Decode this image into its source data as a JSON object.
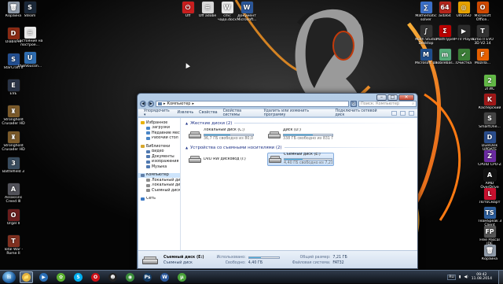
{
  "desktop": {
    "icons_left": [
      {
        "label": "Корзина",
        "color": "#8f9aa8",
        "icon": "recycle-bin-icon",
        "glyph": "🗑"
      },
      {
        "label": "Diablo III",
        "color": "#8a2a14",
        "icon": "diablo-icon",
        "glyph": "D"
      },
      {
        "label": "StarCraft II",
        "color": "#234e8f",
        "icon": "starcraft-icon",
        "glyph": "S"
      },
      {
        "label": "EVE",
        "color": "#2a3447",
        "icon": "eve-icon",
        "glyph": "E"
      },
      {
        "label": "Stronghold Crusader HD",
        "color": "#7b5a2a",
        "icon": "stronghold-icon",
        "glyph": "♜"
      },
      {
        "label": "Stronghold Crusader HD",
        "color": "#7b5a2a",
        "icon": "stronghold-icon",
        "glyph": "♜"
      },
      {
        "label": "Battlefield 3",
        "color": "#394c5e",
        "icon": "battlefield-icon",
        "glyph": "3"
      },
      {
        "label": "Assassins Creed III",
        "color": "#52525a",
        "icon": "assassins-icon",
        "glyph": "A"
      },
      {
        "label": "Orgel II",
        "color": "#6b1d1d",
        "icon": "game-icon",
        "glyph": "O"
      },
      {
        "label": "Total War - Rome II",
        "color": "#803020",
        "icon": "totalwar-icon",
        "glyph": "T"
      }
    ],
    "icons_left2": [
      {
        "label": "Steam",
        "color": "#1b2838",
        "icon": "steam-icon",
        "glyph": "S"
      },
      {
        "label": "Состояние на построе...",
        "color": "#e8e8e8",
        "icon": "document-icon",
        "glyph": "≡"
      },
      {
        "label": "USBVoucon...",
        "color": "#2f6db0",
        "icon": "usb-icon",
        "glyph": "U"
      }
    ],
    "icons_top": [
      {
        "label": "Off",
        "color": "#c81e1e",
        "icon": "power-icon",
        "glyph": "⏻"
      },
      {
        "label": "Off adobe",
        "color": "#d8d8d8",
        "icon": "document-icon",
        "glyph": "≡"
      },
      {
        "label": "cmc чадо.docx",
        "color": "#e8e8e8",
        "icon": "word-document-icon",
        "glyph": "W"
      },
      {
        "label": "Документ Microsoft...",
        "color": "#2b579a",
        "icon": "word-document-icon",
        "glyph": "W"
      }
    ],
    "icons_right": [
      {
        "label": "Mathematic solver",
        "color": "#3b6fc8",
        "icon": "math-icon",
        "glyph": "∑"
      },
      {
        "label": "aida64",
        "color": "#b4261c",
        "icon": "aida-icon",
        "glyph": "64"
      },
      {
        "label": "UltraISO",
        "color": "#e5a100",
        "icon": "ultraiso-icon",
        "glyph": "◎"
      },
      {
        "label": "Microsoft Office..",
        "color": "#d04a02",
        "icon": "office-icon",
        "glyph": "O"
      },
      {
        "label": "Math Studio Desktop",
        "color": "#333",
        "icon": "mathstudio-icon",
        "glyph": "∫"
      },
      {
        "label": "MathType",
        "color": "#b00",
        "icon": "mathtype-icon",
        "glyph": "Σ"
      },
      {
        "label": "IP-TV Player",
        "color": "#2a2a2a",
        "icon": "iptv-icon",
        "glyph": "▶"
      },
      {
        "label": "Turbo II EVO 3D V2.14",
        "color": "#333",
        "icon": "turbo-icon",
        "glyph": "T"
      },
      {
        "label": "Microsoft 13",
        "color": "#1f4e8c",
        "icon": "app-icon",
        "glyph": "M"
      },
      {
        "label": "mobilebas...",
        "color": "#5a7",
        "icon": "app-icon",
        "glyph": "m"
      },
      {
        "label": "Очистка",
        "color": "#3a7d36",
        "icon": "cleaner-icon",
        "glyph": "✔"
      },
      {
        "label": "Mozilla...",
        "color": "#e66000",
        "icon": "firefox-icon",
        "glyph": "F"
      },
      {
        "label": "2ГИС",
        "color": "#62b846",
        "icon": "2gis-icon",
        "glyph": "2"
      },
      {
        "label": "Касперский",
        "color": "#a01818",
        "icon": "kaspersky-icon",
        "glyph": "K"
      },
      {
        "label": "SmartOne...",
        "color": "#444",
        "icon": "app-icon",
        "glyph": "S"
      },
      {
        "label": "DuelDisk UPDATE",
        "color": "#2a4d8c",
        "icon": "app-icon",
        "glyph": "D"
      },
      {
        "label": "CPUID CPU-Z",
        "color": "#6a2aa0",
        "icon": "cpuz-icon",
        "glyph": "Z"
      },
      {
        "label": "AMD OverDrive",
        "color": "#111",
        "icon": "amd-icon",
        "glyph": "A"
      },
      {
        "label": "ЛотоСмарт",
        "color": "#c8102e",
        "icon": "app-icon",
        "glyph": "L"
      },
      {
        "label": "ТеамSpeak 3 Client",
        "color": "#2d5f9e",
        "icon": "teamspeak-icon",
        "glyph": "TS"
      },
      {
        "label": "Free Pascal IDE",
        "color": "#555",
        "icon": "pascal-icon",
        "glyph": "FP"
      },
      {
        "label": "Корзина",
        "color": "#8f9aa8",
        "icon": "recycle-bin-icon",
        "glyph": "🗑"
      }
    ]
  },
  "explorer": {
    "address": "Компьютер",
    "search_placeholder": "Поиск: Компьютер",
    "toolbar": [
      "Упорядочить ▾",
      "Извлечь",
      "Свойства",
      "Свойства системы",
      "Удалить или изменить программу",
      "Подключить сетевой диск"
    ],
    "nav": [
      {
        "label": "Избранное",
        "level": 0,
        "color": "#e9b200"
      },
      {
        "label": "Загрузки",
        "level": 1,
        "color": "#4a86c6"
      },
      {
        "label": "Недавние места",
        "level": 1,
        "color": "#4a86c6"
      },
      {
        "label": "Рабочий стол",
        "level": 1,
        "color": "#4a86c6"
      },
      {
        "label": "",
        "level": -1
      },
      {
        "label": "Библиотеки",
        "level": 0,
        "color": "#d7a72c"
      },
      {
        "label": "Видео",
        "level": 1,
        "color": "#5079b0"
      },
      {
        "label": "Документы",
        "level": 1,
        "color": "#5079b0"
      },
      {
        "label": "Изображения",
        "level": 1,
        "color": "#5079b0"
      },
      {
        "label": "Музыка",
        "level": 1,
        "color": "#5079b0"
      },
      {
        "label": "",
        "level": -1
      },
      {
        "label": "Компьютер",
        "level": 0,
        "color": "#607fa8",
        "selected": true
      },
      {
        "label": "Локальный диск (C:)",
        "level": 1,
        "color": "#8c8c8c"
      },
      {
        "label": "Локальный диск (D:)",
        "level": 1,
        "color": "#8c8c8c"
      },
      {
        "label": "Съемный диск (E:)",
        "level": 1,
        "color": "#8c8c8c"
      },
      {
        "label": "",
        "level": -1
      },
      {
        "label": "Сеть",
        "level": 0,
        "color": "#3a78c3"
      }
    ],
    "groups": [
      {
        "title": "Жесткие диски (2)",
        "drives": [
          {
            "name": "Локальный диск (C:)",
            "free": "36,7 ГБ свободно из 80,0 ГБ",
            "used": 0.54,
            "icon": "windows-drive-icon"
          },
          {
            "name": "Диск (D:)",
            "free": "338 ГБ свободно из 831 ГБ",
            "used": 0.59,
            "icon": "hard-drive-icon"
          }
        ]
      },
      {
        "title": "Устройства со съемными носителями (2)",
        "drives": [
          {
            "name": "DVD RW дисковод (I:)",
            "free": "",
            "used": null,
            "icon": "dvd-drive-icon"
          },
          {
            "name": "Съемный диск (E:)",
            "free": "4,40 ГБ свободно из 7,21 ГБ",
            "used": 0.39,
            "icon": "removable-drive-icon",
            "selected": true
          }
        ]
      }
    ],
    "details": {
      "name": "Съемный диск (E:)",
      "type": "Съемный диск",
      "used_label": "Использовано:",
      "free_label": "Свободно:",
      "free": "4,40 ГБ",
      "total_label": "Общий размер:",
      "total": "7,21 ГБ",
      "fs_label": "Файловая система:",
      "fs": "FAT32",
      "used": 0.39
    }
  },
  "taskbar": {
    "start_glyph": "⊞",
    "apps": [
      {
        "name": "explorer-taskbar-button",
        "glyph": "📁",
        "color": "#e2b33d",
        "active": true
      },
      {
        "name": "media-player-taskbar-button",
        "glyph": "▶",
        "color": "#2b6fb6"
      },
      {
        "name": "icq-taskbar-button",
        "glyph": "✿",
        "color": "#5bb12f"
      },
      {
        "name": "skype-taskbar-button",
        "glyph": "S",
        "color": "#00aff0"
      },
      {
        "name": "opera-taskbar-button",
        "glyph": "O",
        "color": "#cc0f16"
      },
      {
        "name": "game-taskbar-button",
        "glyph": "☻",
        "color": "#222"
      },
      {
        "name": "chrome-taskbar-button",
        "glyph": "◉",
        "color": "#3c8e3c"
      },
      {
        "name": "photoshop-taskbar-button",
        "glyph": "Ps",
        "color": "#123a63"
      },
      {
        "name": "word-taskbar-button",
        "glyph": "W",
        "color": "#2b579a"
      },
      {
        "name": "utorrent-taskbar-button",
        "glyph": "µ",
        "color": "#4aa33a"
      }
    ],
    "lang": "RU",
    "time": "09:42",
    "date": "11.08.2014"
  }
}
